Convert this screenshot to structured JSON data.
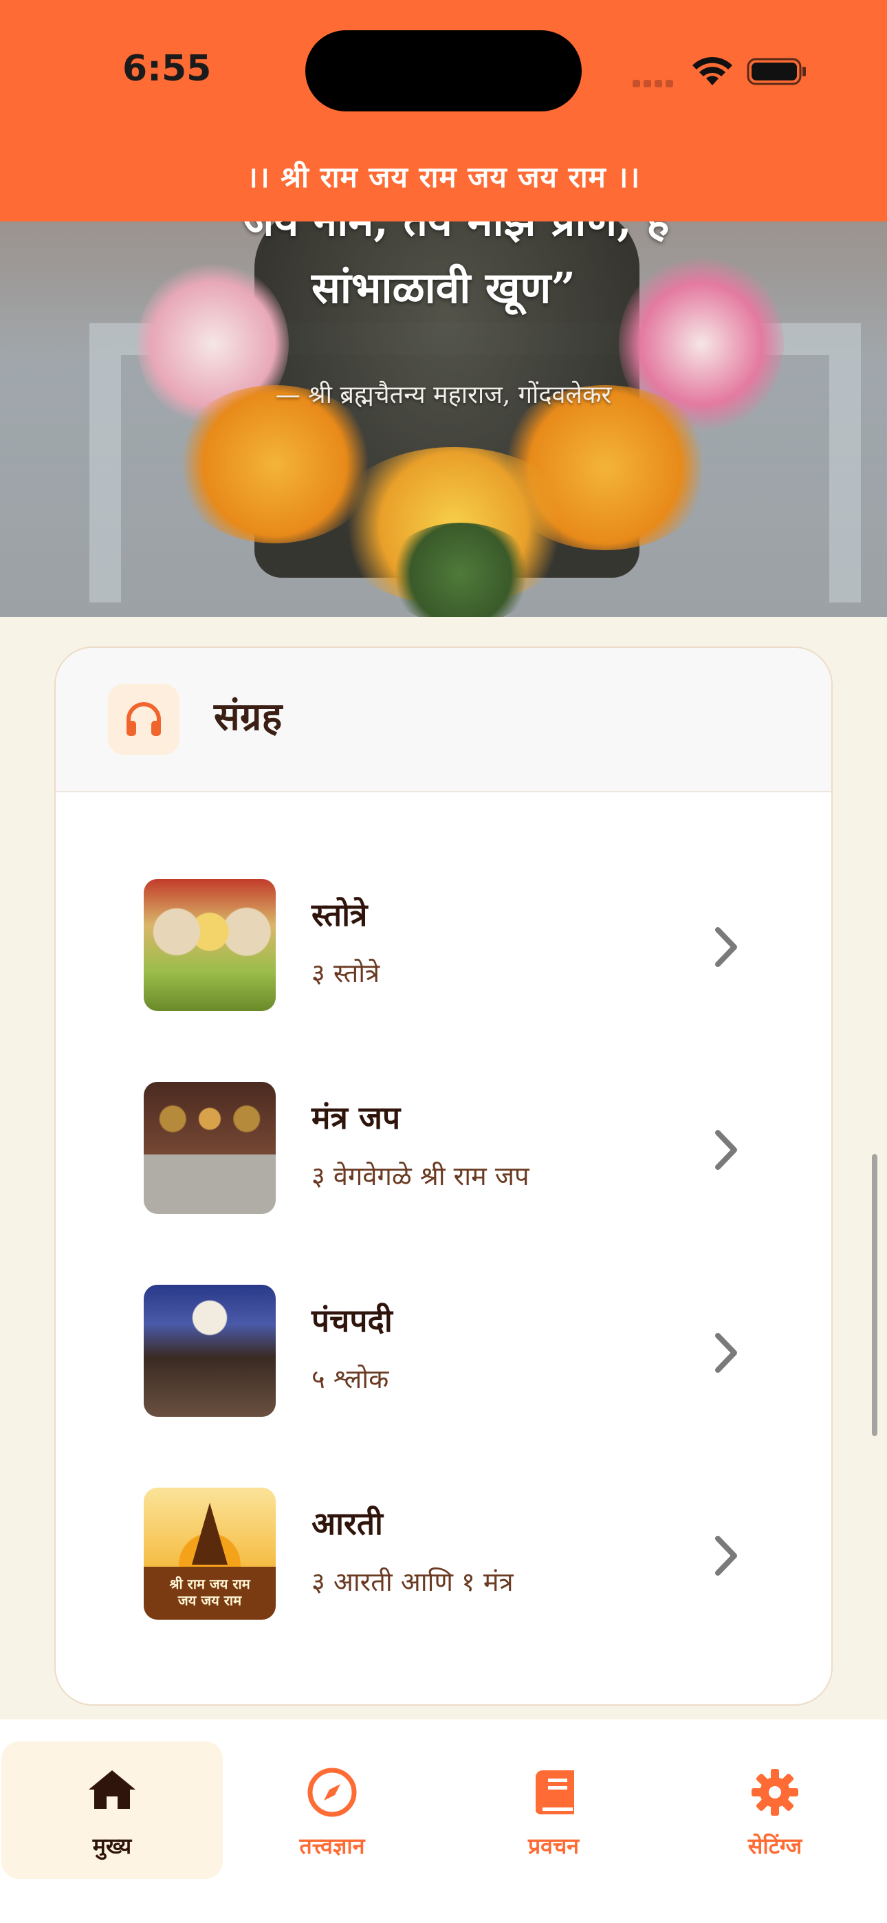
{
  "status_bar": {
    "time": "6:55"
  },
  "header": {
    "title": "।। श्री राम जय राम जय जय राम ।।"
  },
  "hero": {
    "quote_line1": "“जय नाम, तय माझे प्राण, हे",
    "quote_line2": "सांभाळावी खूण”",
    "author": "— श्री ब्रह्मचैतन्य महाराज, गोंदवलेकर"
  },
  "collection": {
    "icon": "headphones-icon",
    "title": "संग्रह",
    "items": [
      {
        "title": "स्तोत्रे",
        "subtitle": "३ स्तोत्रे"
      },
      {
        "title": "मंत्र जप",
        "subtitle": "३ वेगवेगळे श्री राम जप"
      },
      {
        "title": "पंचपदी",
        "subtitle": "५ श्लोक"
      },
      {
        "title": "आरती",
        "subtitle": "३ आरती आणि १ मंत्र",
        "thumb_text_1": "श्री राम जय राम",
        "thumb_text_2": "जय जय राम"
      }
    ]
  },
  "tabs": [
    {
      "label": "मुख्य",
      "icon": "home-icon",
      "active": true
    },
    {
      "label": "तत्त्वज्ञान",
      "icon": "compass-icon",
      "active": false
    },
    {
      "label": "प्रवचन",
      "icon": "book-icon",
      "active": false
    },
    {
      "label": "सेटिंग्ज",
      "icon": "gear-icon",
      "active": false
    }
  ],
  "colors": {
    "accent": "#fe6b34",
    "background": "#f7f3e6",
    "text_dark": "#2f140b",
    "text_sub": "#6a3a22"
  }
}
